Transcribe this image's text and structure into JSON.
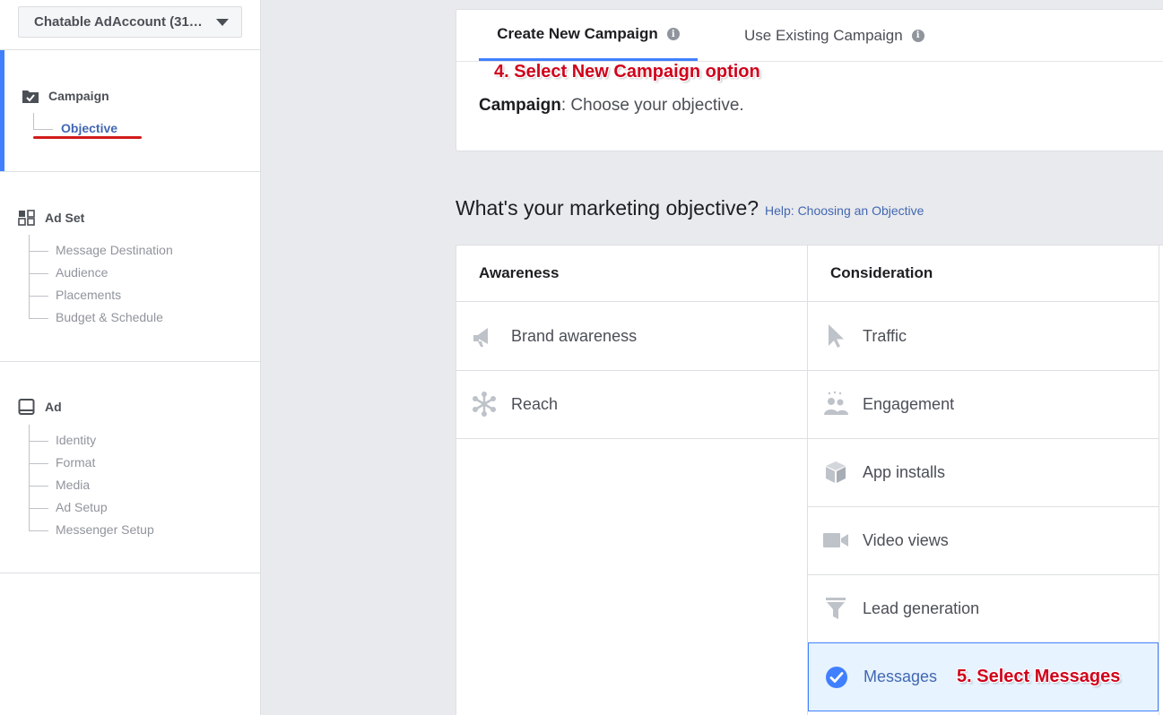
{
  "sidebar": {
    "account_label": "Chatable AdAccount (31…",
    "campaign": {
      "title": "Campaign",
      "active_item": "Objective"
    },
    "adset": {
      "title": "Ad Set",
      "items": [
        "Message Destination",
        "Audience",
        "Placements",
        "Budget & Schedule"
      ]
    },
    "ad": {
      "title": "Ad",
      "items": [
        "Identity",
        "Format",
        "Media",
        "Ad Setup",
        "Messenger Setup"
      ]
    }
  },
  "campaign_card": {
    "tabs": [
      {
        "label": "Create New Campaign",
        "active": true
      },
      {
        "label": "Use Existing Campaign",
        "active": false
      }
    ],
    "annotation": "4. Select New Campaign option",
    "campaign_label": "Campaign",
    "campaign_text": ": Choose your objective."
  },
  "objectives": {
    "title": "What's your marketing objective?",
    "help_link": "Help: Choosing an Objective",
    "columns": [
      {
        "header": "Awareness",
        "items": [
          "Brand awareness",
          "Reach"
        ]
      },
      {
        "header": "Consideration",
        "items": [
          "Traffic",
          "Engagement",
          "App installs",
          "Video views",
          "Lead generation",
          "Messages"
        ]
      }
    ],
    "selected": "Messages",
    "annotation": "5. Select Messages"
  },
  "colors": {
    "accent": "#4080ff",
    "link": "#4267b2",
    "annotation_red": "#d0021b",
    "selected_bg": "#e7f3ff"
  }
}
